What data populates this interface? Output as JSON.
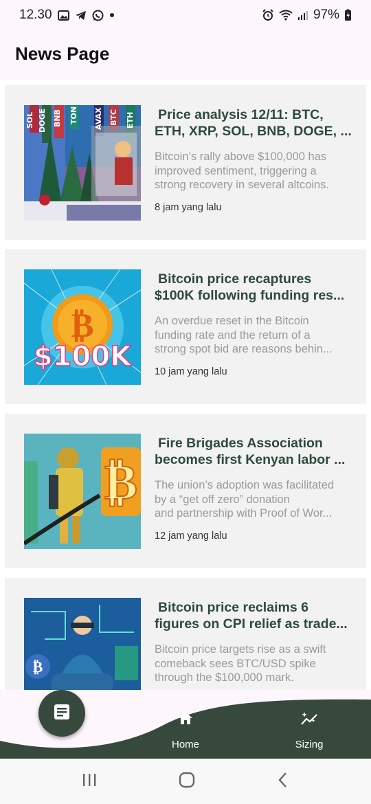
{
  "status_bar": {
    "time": "12.30",
    "battery": "97%"
  },
  "header": {
    "title": "News Page"
  },
  "articles": [
    {
      "title_line1": "Price analysis 12/11: BTC,",
      "title_line2": "ETH, XRP, SOL, BNB, DOGE, ...",
      "summary_line1": "Bitcoin’s rally above $100,000 has",
      "summary_line2": "improved sentiment, triggering a",
      "summary_line3": "strong recovery in several altcoins.",
      "time": "8 jam yang lalu",
      "image_tickers": [
        "SOL",
        "DOGE",
        "BNB",
        "TON",
        "AVAX",
        "BTC",
        "ETH"
      ]
    },
    {
      "title_line1": "Bitcoin price recaptures",
      "title_line2": "$100K following funding res...",
      "summary_line1": "An overdue reset in the Bitcoin",
      "summary_line2": "funding rate and the return of a",
      "summary_line3": "strong spot bid are reasons behin...",
      "time": "10 jam yang lalu",
      "image_text": "$100K"
    },
    {
      "title_line1": "Fire Brigades Association",
      "title_line2": "becomes first Kenyan labor ...",
      "summary_line1": "The union’s adoption was facilitated",
      "summary_line2": "by a “get off zero” donation",
      "summary_line3": "and partnership with Proof of Wor...",
      "time": "12 jam yang lalu"
    },
    {
      "title_line1": "Bitcoin price reclaims 6",
      "title_line2": "figures on CPI relief as trade...",
      "summary_line1": "Bitcoin price targets rise as a swift",
      "summary_line2": "comeback sees BTC/USD spike",
      "summary_line3": "through the $100,000 mark.",
      "time": ""
    }
  ],
  "bottom_nav": {
    "fab_icon": "article-icon",
    "items": [
      {
        "label": "Home",
        "icon": "home-icon"
      },
      {
        "label": "Sizing",
        "icon": "sparkle-chart-icon"
      }
    ]
  },
  "colors": {
    "accent": "#36493c",
    "title_text": "#2d4a3b",
    "summary_text": "#9a9a9a",
    "card_bg": "#f2f2f2",
    "page_bg": "#fdf6fd"
  }
}
